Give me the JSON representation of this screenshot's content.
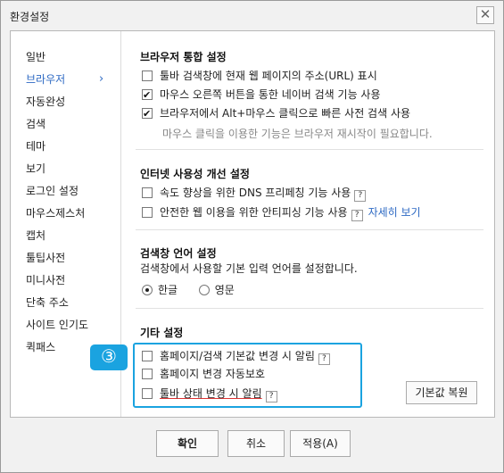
{
  "window": {
    "title": "환경설정",
    "close_label": "✕"
  },
  "sidebar": {
    "items": [
      {
        "label": "일반"
      },
      {
        "label": "브라우저",
        "active": true
      },
      {
        "label": "자동완성"
      },
      {
        "label": "검색"
      },
      {
        "label": "테마"
      },
      {
        "label": "보기"
      },
      {
        "label": "로그인 설정"
      },
      {
        "label": "마우스제스처"
      },
      {
        "label": "캡처"
      },
      {
        "label": "툴팁사전"
      },
      {
        "label": "미니사전"
      },
      {
        "label": "단축 주소"
      },
      {
        "label": "사이트 인기도"
      },
      {
        "label": "퀵패스"
      }
    ],
    "active_indicator": "›"
  },
  "sections": {
    "browser": {
      "title": "브라우저 통합 설정",
      "options": [
        {
          "label": "툴바 검색창에 현재 웹 페이지의 주소(URL) 표시",
          "checked": false
        },
        {
          "label": "마우스 오른쪽 버튼을 통한 네이버 검색 기능 사용",
          "checked": true
        },
        {
          "label": "브라우저에서 Alt+마우스 클릭으로 빠른 사전 검색 사용",
          "checked": true
        }
      ],
      "note": "마우스 클릭을 이용한 기능은 브라우저 재시작이 필요합니다."
    },
    "internet": {
      "title": "인터넷 사용성 개선 설정",
      "options": [
        {
          "label": "속도 향상을 위한 DNS 프리페칭 기능 사용",
          "checked": false,
          "help": "?"
        },
        {
          "label": "안전한 웹 이용을 위한 안티피싱 기능 사용",
          "checked": false,
          "help": "?",
          "link": "자세히 보기"
        }
      ]
    },
    "language": {
      "title": "검색창 언어 설정",
      "description": "검색창에서 사용할 기본 입력 언어를 설정합니다.",
      "radios": [
        {
          "label": "한글",
          "checked": true
        },
        {
          "label": "영문",
          "checked": false
        }
      ]
    },
    "other": {
      "title": "기타 설정",
      "options": [
        {
          "label": "홈페이지/검색 기본값 변경 시 알림",
          "checked": false,
          "help": "?"
        },
        {
          "label": "홈페이지 변경 자동보호",
          "checked": false
        },
        {
          "label": "툴바 상태 변경 시 알림",
          "checked": false,
          "help": "?"
        }
      ],
      "badge": "③",
      "default_button": "기본값 복원"
    }
  },
  "footer": {
    "ok": "확인",
    "cancel": "취소",
    "apply": "적용(A)"
  }
}
